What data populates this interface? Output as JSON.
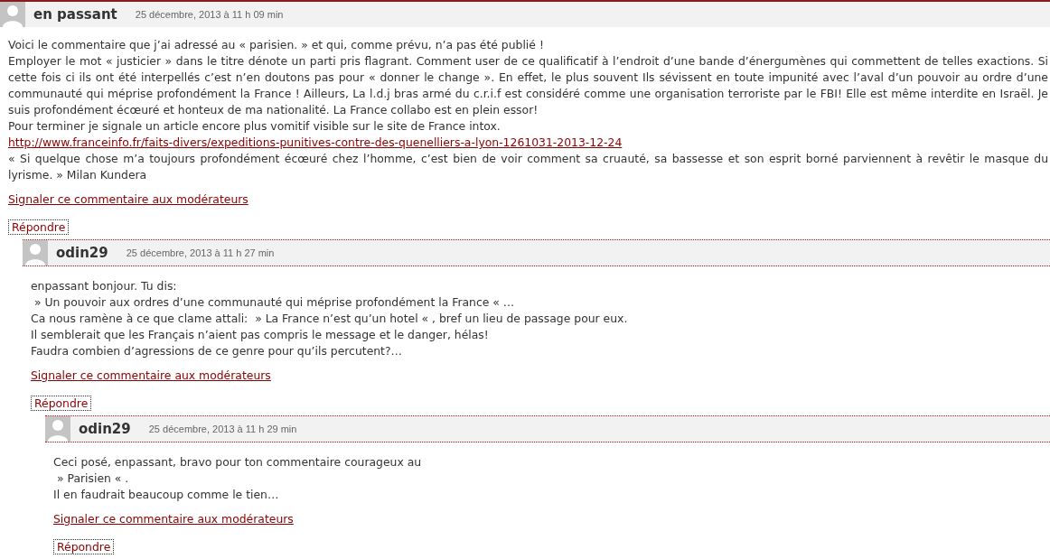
{
  "comments": [
    {
      "author": "en passant",
      "date": "25 décembre, 2013 à 11 h 09 min",
      "first": true,
      "body": [
        {
          "kind": "text",
          "text": "Voici le commentaire que j’ai adressé au « parisien. » et qui, comme prévu, n’a pas été publié !"
        },
        {
          "kind": "text",
          "text": "Employer le mot « justicier » dans le titre dénote un parti pris flagrant. Comment user de ce qualificatif à l’endroit d’une bande d’énergumènes qui commettent de telles exactions. Si cette fois ci ils ont été interpellés c’est n’en doutons pas pour « donner le change ». En effet, le plus souvent Ils sévissent en toute impunité avec l’aval d’un pouvoir au ordre d’une communauté qui méprise profondément la France ! Ailleurs, La l.d.j bras armé du c.r.i.f est considéré comme une organisation terroriste par le FBI! Elle est même interdite en Israël. Je suis profondément écœuré et honteux de ma nationalité. La France collabo est en plein essor!"
        },
        {
          "kind": "text",
          "text": "Pour terminer je signale un article encore plus vomitif visible sur le site de France intox."
        },
        {
          "kind": "link",
          "text": "http://www.franceinfo.fr/faits-divers/expeditions-punitives-contre-des-quenelliers-a-lyon-1261031-2013-12-24"
        },
        {
          "kind": "text",
          "text": "« Si quelque chose m’a toujours profondément écœuré chez l’homme, c’est bien de voir comment sa cruauté, sa bassesse et son esprit borné parviennent à revêtir le masque du lyrisme. » Milan Kundera"
        }
      ],
      "report": "Signaler ce commentaire aux modérateurs",
      "reply": "Répondre",
      "children": [
        {
          "author": "odin29",
          "date": "25 décembre, 2013 à 11 h 27 min",
          "first": false,
          "body": [
            {
              "kind": "text",
              "text": "enpassant bonjour. Tu dis:"
            },
            {
              "kind": "text",
              "text": " » Un pouvoir aux ordres d’une communauté qui méprise profondément la France « …"
            },
            {
              "kind": "text",
              "text": "Ca nous ramène à ce que clame attali:  » La France n’est qu’un hotel « , bref un lieu de passage pour eux."
            },
            {
              "kind": "text",
              "text": "Il semblerait que les Français n’aient pas compris le message et le danger, hélas!"
            },
            {
              "kind": "text",
              "text": "Faudra combien d’agressions de ce genre pour qu’ils percutent?…"
            }
          ],
          "report": "Signaler ce commentaire aux modérateurs",
          "reply": "Répondre",
          "children": [
            {
              "author": "odin29",
              "date": "25 décembre, 2013 à 11 h 29 min",
              "first": false,
              "body": [
                {
                  "kind": "text",
                  "text": "Ceci posé, enpassant, bravo pour ton commentaire courageux au"
                },
                {
                  "kind": "text",
                  "text": " » Parisien « ."
                },
                {
                  "kind": "text",
                  "text": "Il en faudrait beaucoup comme le tien…"
                }
              ],
              "report": "Signaler ce commentaire aux modérateurs",
              "reply": "Répondre"
            }
          ]
        }
      ]
    }
  ]
}
